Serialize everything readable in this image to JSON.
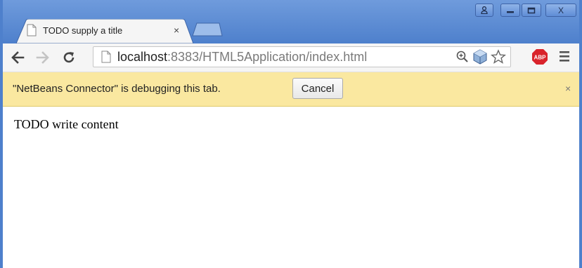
{
  "window": {
    "controls": {
      "user": "user",
      "minimize": "minimize",
      "maximize": "maximize",
      "close": "X"
    }
  },
  "tabs": [
    {
      "title": "TODO supply a title",
      "close_label": "×",
      "active": true
    }
  ],
  "toolbar": {
    "url_host": "localhost",
    "url_rest": ":8383/HTML5Application/index.html",
    "extensions": [
      "zoom-icon",
      "netbeans-cube-icon",
      "star-icon"
    ],
    "abp_label": "ABP"
  },
  "infobar": {
    "message": "\"NetBeans Connector\" is debugging this tab.",
    "cancel_label": "Cancel",
    "close_label": "×"
  },
  "page": {
    "text": "TODO write content"
  },
  "colors": {
    "frame": "#4e80cc",
    "infobar": "#fae8a0",
    "abp": "#d9232b"
  }
}
